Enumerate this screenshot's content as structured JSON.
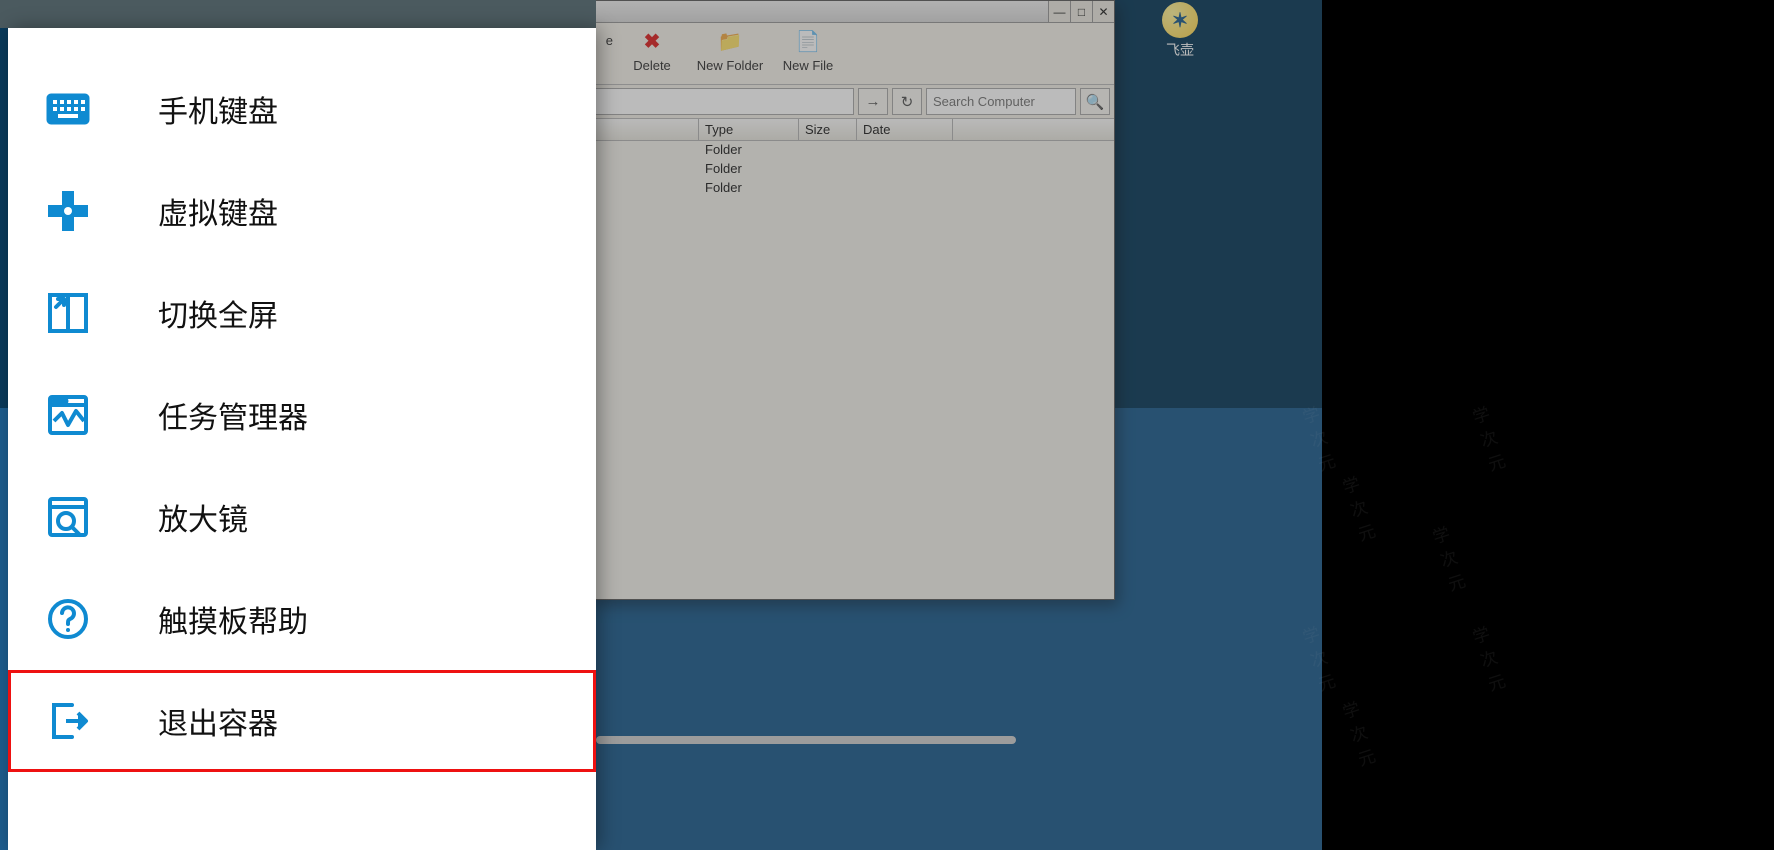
{
  "desktop": {
    "icon_label": "飞壶",
    "watermark_text": "学次元"
  },
  "filewin": {
    "toolbar": {
      "partial_suffix": "e",
      "delete": "Delete",
      "new_folder": "New Folder",
      "new_file": "New File"
    },
    "nav": {
      "go_glyph": "→",
      "reload_glyph": "↻",
      "search_glyph": "🔍"
    },
    "search_placeholder": "Search Computer",
    "headers": {
      "type": "Type",
      "size": "Size",
      "date": "Date"
    },
    "rows": [
      {
        "type": "Folder"
      },
      {
        "type": "Folder"
      },
      {
        "type": "Folder"
      }
    ],
    "winctl": {
      "min": "—",
      "max": "□",
      "close": "✕"
    }
  },
  "panel": {
    "items": [
      {
        "key": "phone-keyboard",
        "label": "手机键盘"
      },
      {
        "key": "virtual-keyboard",
        "label": "虚拟键盘"
      },
      {
        "key": "fullscreen",
        "label": "切换全屏"
      },
      {
        "key": "task-manager",
        "label": "任务管理器"
      },
      {
        "key": "magnifier",
        "label": "放大镜"
      },
      {
        "key": "touchpad-help",
        "label": "触摸板帮助"
      },
      {
        "key": "exit-container",
        "label": "退出容器"
      }
    ],
    "highlight_key": "exit-container"
  }
}
